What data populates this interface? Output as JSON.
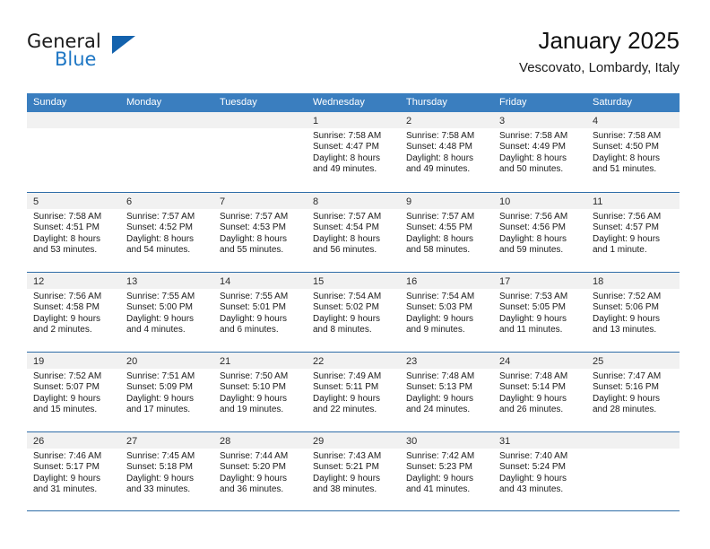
{
  "brand": {
    "name_part1": "General",
    "name_part2": "Blue",
    "accent_color": "#1362ad"
  },
  "header": {
    "title": "January 2025",
    "subtitle": "Vescovato, Lombardy, Italy"
  },
  "calendar": {
    "header_bg": "#3a7ebf",
    "weekdays": [
      "Sunday",
      "Monday",
      "Tuesday",
      "Wednesday",
      "Thursday",
      "Friday",
      "Saturday"
    ],
    "weeks": [
      [
        {
          "day": "",
          "sunrise": "",
          "sunset": "",
          "daylight1": "",
          "daylight2": "",
          "empty": true
        },
        {
          "day": "",
          "sunrise": "",
          "sunset": "",
          "daylight1": "",
          "daylight2": "",
          "empty": true
        },
        {
          "day": "",
          "sunrise": "",
          "sunset": "",
          "daylight1": "",
          "daylight2": "",
          "empty": true
        },
        {
          "day": "1",
          "sunrise": "Sunrise: 7:58 AM",
          "sunset": "Sunset: 4:47 PM",
          "daylight1": "Daylight: 8 hours",
          "daylight2": "and 49 minutes."
        },
        {
          "day": "2",
          "sunrise": "Sunrise: 7:58 AM",
          "sunset": "Sunset: 4:48 PM",
          "daylight1": "Daylight: 8 hours",
          "daylight2": "and 49 minutes."
        },
        {
          "day": "3",
          "sunrise": "Sunrise: 7:58 AM",
          "sunset": "Sunset: 4:49 PM",
          "daylight1": "Daylight: 8 hours",
          "daylight2": "and 50 minutes."
        },
        {
          "day": "4",
          "sunrise": "Sunrise: 7:58 AM",
          "sunset": "Sunset: 4:50 PM",
          "daylight1": "Daylight: 8 hours",
          "daylight2": "and 51 minutes."
        }
      ],
      [
        {
          "day": "5",
          "sunrise": "Sunrise: 7:58 AM",
          "sunset": "Sunset: 4:51 PM",
          "daylight1": "Daylight: 8 hours",
          "daylight2": "and 53 minutes."
        },
        {
          "day": "6",
          "sunrise": "Sunrise: 7:57 AM",
          "sunset": "Sunset: 4:52 PM",
          "daylight1": "Daylight: 8 hours",
          "daylight2": "and 54 minutes."
        },
        {
          "day": "7",
          "sunrise": "Sunrise: 7:57 AM",
          "sunset": "Sunset: 4:53 PM",
          "daylight1": "Daylight: 8 hours",
          "daylight2": "and 55 minutes."
        },
        {
          "day": "8",
          "sunrise": "Sunrise: 7:57 AM",
          "sunset": "Sunset: 4:54 PM",
          "daylight1": "Daylight: 8 hours",
          "daylight2": "and 56 minutes."
        },
        {
          "day": "9",
          "sunrise": "Sunrise: 7:57 AM",
          "sunset": "Sunset: 4:55 PM",
          "daylight1": "Daylight: 8 hours",
          "daylight2": "and 58 minutes."
        },
        {
          "day": "10",
          "sunrise": "Sunrise: 7:56 AM",
          "sunset": "Sunset: 4:56 PM",
          "daylight1": "Daylight: 8 hours",
          "daylight2": "and 59 minutes."
        },
        {
          "day": "11",
          "sunrise": "Sunrise: 7:56 AM",
          "sunset": "Sunset: 4:57 PM",
          "daylight1": "Daylight: 9 hours",
          "daylight2": "and 1 minute."
        }
      ],
      [
        {
          "day": "12",
          "sunrise": "Sunrise: 7:56 AM",
          "sunset": "Sunset: 4:58 PM",
          "daylight1": "Daylight: 9 hours",
          "daylight2": "and 2 minutes."
        },
        {
          "day": "13",
          "sunrise": "Sunrise: 7:55 AM",
          "sunset": "Sunset: 5:00 PM",
          "daylight1": "Daylight: 9 hours",
          "daylight2": "and 4 minutes."
        },
        {
          "day": "14",
          "sunrise": "Sunrise: 7:55 AM",
          "sunset": "Sunset: 5:01 PM",
          "daylight1": "Daylight: 9 hours",
          "daylight2": "and 6 minutes."
        },
        {
          "day": "15",
          "sunrise": "Sunrise: 7:54 AM",
          "sunset": "Sunset: 5:02 PM",
          "daylight1": "Daylight: 9 hours",
          "daylight2": "and 8 minutes."
        },
        {
          "day": "16",
          "sunrise": "Sunrise: 7:54 AM",
          "sunset": "Sunset: 5:03 PM",
          "daylight1": "Daylight: 9 hours",
          "daylight2": "and 9 minutes."
        },
        {
          "day": "17",
          "sunrise": "Sunrise: 7:53 AM",
          "sunset": "Sunset: 5:05 PM",
          "daylight1": "Daylight: 9 hours",
          "daylight2": "and 11 minutes."
        },
        {
          "day": "18",
          "sunrise": "Sunrise: 7:52 AM",
          "sunset": "Sunset: 5:06 PM",
          "daylight1": "Daylight: 9 hours",
          "daylight2": "and 13 minutes."
        }
      ],
      [
        {
          "day": "19",
          "sunrise": "Sunrise: 7:52 AM",
          "sunset": "Sunset: 5:07 PM",
          "daylight1": "Daylight: 9 hours",
          "daylight2": "and 15 minutes."
        },
        {
          "day": "20",
          "sunrise": "Sunrise: 7:51 AM",
          "sunset": "Sunset: 5:09 PM",
          "daylight1": "Daylight: 9 hours",
          "daylight2": "and 17 minutes."
        },
        {
          "day": "21",
          "sunrise": "Sunrise: 7:50 AM",
          "sunset": "Sunset: 5:10 PM",
          "daylight1": "Daylight: 9 hours",
          "daylight2": "and 19 minutes."
        },
        {
          "day": "22",
          "sunrise": "Sunrise: 7:49 AM",
          "sunset": "Sunset: 5:11 PM",
          "daylight1": "Daylight: 9 hours",
          "daylight2": "and 22 minutes."
        },
        {
          "day": "23",
          "sunrise": "Sunrise: 7:48 AM",
          "sunset": "Sunset: 5:13 PM",
          "daylight1": "Daylight: 9 hours",
          "daylight2": "and 24 minutes."
        },
        {
          "day": "24",
          "sunrise": "Sunrise: 7:48 AM",
          "sunset": "Sunset: 5:14 PM",
          "daylight1": "Daylight: 9 hours",
          "daylight2": "and 26 minutes."
        },
        {
          "day": "25",
          "sunrise": "Sunrise: 7:47 AM",
          "sunset": "Sunset: 5:16 PM",
          "daylight1": "Daylight: 9 hours",
          "daylight2": "and 28 minutes."
        }
      ],
      [
        {
          "day": "26",
          "sunrise": "Sunrise: 7:46 AM",
          "sunset": "Sunset: 5:17 PM",
          "daylight1": "Daylight: 9 hours",
          "daylight2": "and 31 minutes."
        },
        {
          "day": "27",
          "sunrise": "Sunrise: 7:45 AM",
          "sunset": "Sunset: 5:18 PM",
          "daylight1": "Daylight: 9 hours",
          "daylight2": "and 33 minutes."
        },
        {
          "day": "28",
          "sunrise": "Sunrise: 7:44 AM",
          "sunset": "Sunset: 5:20 PM",
          "daylight1": "Daylight: 9 hours",
          "daylight2": "and 36 minutes."
        },
        {
          "day": "29",
          "sunrise": "Sunrise: 7:43 AM",
          "sunset": "Sunset: 5:21 PM",
          "daylight1": "Daylight: 9 hours",
          "daylight2": "and 38 minutes."
        },
        {
          "day": "30",
          "sunrise": "Sunrise: 7:42 AM",
          "sunset": "Sunset: 5:23 PM",
          "daylight1": "Daylight: 9 hours",
          "daylight2": "and 41 minutes."
        },
        {
          "day": "31",
          "sunrise": "Sunrise: 7:40 AM",
          "sunset": "Sunset: 5:24 PM",
          "daylight1": "Daylight: 9 hours",
          "daylight2": "and 43 minutes."
        },
        {
          "day": "",
          "sunrise": "",
          "sunset": "",
          "daylight1": "",
          "daylight2": "",
          "empty": true
        }
      ]
    ]
  }
}
